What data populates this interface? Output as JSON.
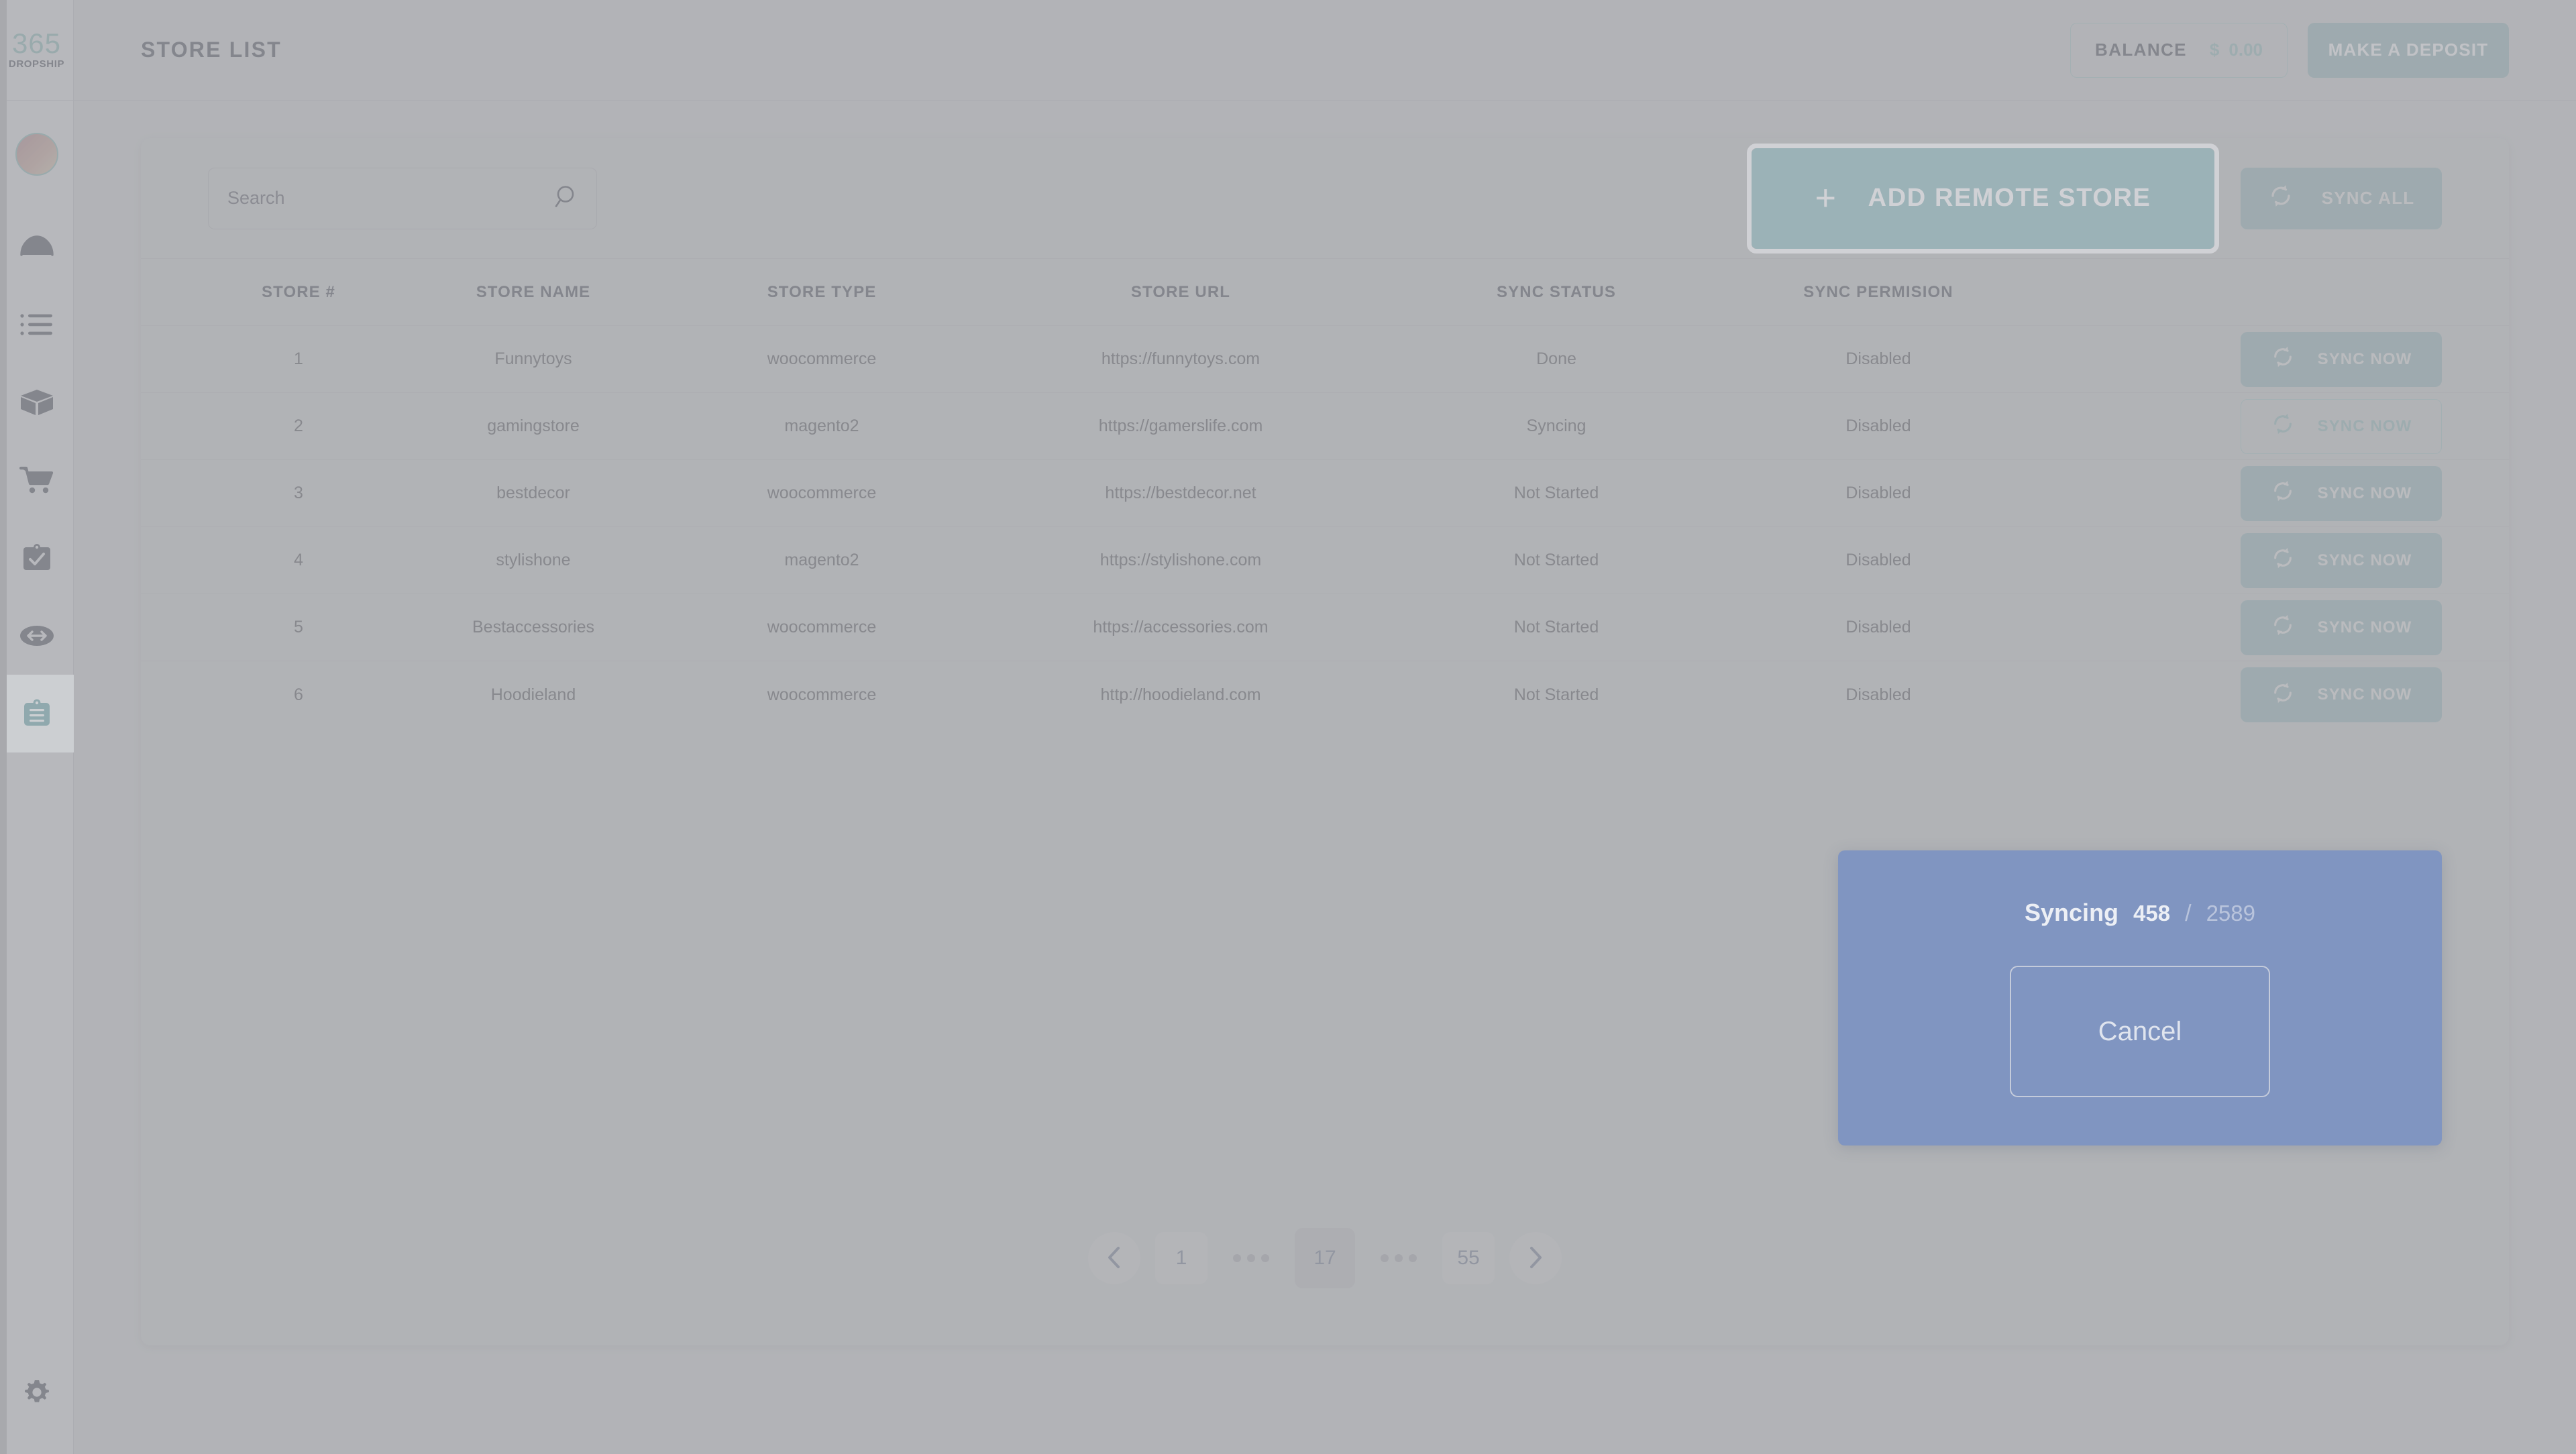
{
  "brand": {
    "logo_text": "365",
    "logo_sub": "DROPSHIP"
  },
  "sidebar": {
    "items": [
      {
        "icon": "speedometer-icon",
        "name": "dashboard"
      },
      {
        "icon": "list-icon",
        "name": "orders"
      },
      {
        "icon": "box-icon",
        "name": "products"
      },
      {
        "icon": "shopping-cart-icon",
        "name": "cart"
      },
      {
        "icon": "clipboard-check-icon",
        "name": "tasks"
      },
      {
        "icon": "exchange-icon",
        "name": "transfers"
      },
      {
        "icon": "clipboard-list-icon",
        "name": "store-list",
        "active": true
      }
    ],
    "settings_icon": "gear-icon"
  },
  "header": {
    "title": "STORE LIST",
    "balance_label": "BALANCE",
    "balance_currency": "$",
    "balance_value": "0.00",
    "deposit_label": "MAKE A DEPOSIT"
  },
  "toolbar": {
    "search_placeholder": "Search",
    "search_value": "",
    "search_icon": "search-icon",
    "add_store_label": "ADD REMOTE STORE",
    "add_store_plus": "+",
    "sync_all_label": "SYNC ALL",
    "sync_icon": "sync-icon"
  },
  "table": {
    "headers": [
      "STORE #",
      "STORE NAME",
      "STORE TYPE",
      "STORE URL",
      "SYNC STATUS",
      "SYNC PERMISION"
    ],
    "rows": [
      {
        "num": "1",
        "name": "Funnytoys",
        "type": "woocommerce",
        "url": "https://funnytoys.com",
        "status": "Done",
        "permission": "Disabled",
        "action_label": "SYNC NOW",
        "action_style": "filled"
      },
      {
        "num": "2",
        "name": "gamingstore",
        "type": "magento2",
        "url": "https://gamerslife.com",
        "status": "Syncing",
        "permission": "Disabled",
        "action_label": "SYNC NOW",
        "action_style": "outline"
      },
      {
        "num": "3",
        "name": "bestdecor",
        "type": "woocommerce",
        "url": "https://bestdecor.net",
        "status": "Not Started",
        "permission": "Disabled",
        "action_label": "SYNC NOW",
        "action_style": "filled"
      },
      {
        "num": "4",
        "name": "stylishone",
        "type": "magento2",
        "url": "https://stylishone.com",
        "status": "Not Started",
        "permission": "Disabled",
        "action_label": "SYNC NOW",
        "action_style": "filled"
      },
      {
        "num": "5",
        "name": "Bestaccessories",
        "type": "woocommerce",
        "url": "https://accessories.com",
        "status": "Not Started",
        "permission": "Disabled",
        "action_label": "SYNC NOW",
        "action_style": "filled"
      },
      {
        "num": "6",
        "name": "Hoodieland",
        "type": "woocommerce",
        "url": "http://hoodieland.com",
        "status": "Not Started",
        "permission": "Disabled",
        "action_label": "SYNC NOW",
        "action_style": "filled"
      }
    ]
  },
  "pagination": {
    "prev_icon": "chevron-left-icon",
    "next_icon": "chevron-right-icon",
    "first_page": "1",
    "current_page": "17",
    "last_page": "55",
    "ellipsis": "•••"
  },
  "sync_modal": {
    "label": "Syncing",
    "current": "458",
    "separator": "/",
    "total": "2589",
    "cancel_label": "Cancel"
  },
  "colors": {
    "accent_teal": "#67d2de",
    "muted_teal": "#84bfc1",
    "text_slate": "#6d7285",
    "modal_blue": "#8095c1",
    "page_bg": "#c3c4c6"
  }
}
